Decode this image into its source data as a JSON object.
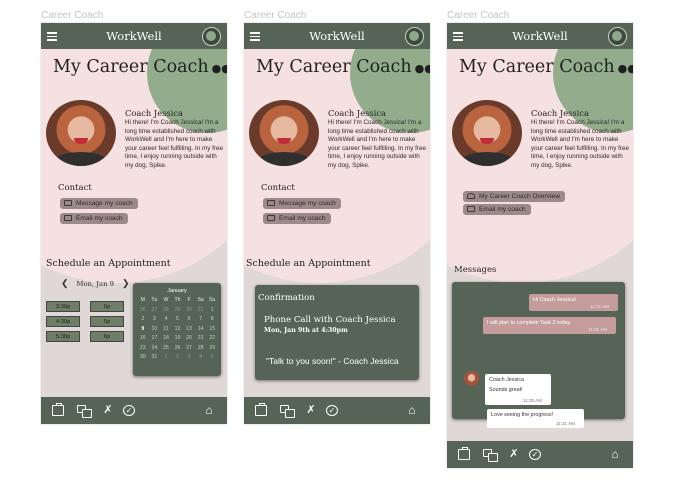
{
  "frames": [
    {
      "label": "Career Coach"
    },
    {
      "label": "Career Coach"
    },
    {
      "label": "Career Coach"
    }
  ],
  "app": {
    "title": "WorkWell"
  },
  "profile": {
    "heading": "My Career Coach",
    "owl_icon": "owl-icon",
    "coach_name": "Coach Jessica",
    "bio": "Hi there! I'm Coach Jessica! I'm a long time established coach with WorkWell and I'm here to make your career feel fulfilling. In my free time, I enjoy running outside with my dog, Spike."
  },
  "contact": {
    "title": "Contact",
    "message_label": "Message my coach",
    "email_label": "Email my coach"
  },
  "schedule": {
    "title": "Schedule an Appointment",
    "date": "Mon, Jan 9",
    "slots": [
      "3:30p",
      "6p",
      "4:30p",
      "5p",
      "5:30p",
      "6p"
    ]
  },
  "calendar": {
    "month": "January",
    "weekdays": [
      "M",
      "Tu",
      "W",
      "Th",
      "F",
      "Sa",
      "Su"
    ],
    "days": [
      "26",
      "27",
      "28",
      "29",
      "30",
      "31",
      "1",
      "2",
      "3",
      "4",
      "5",
      "6",
      "7",
      "8",
      "9",
      "10",
      "11",
      "12",
      "13",
      "14",
      "15",
      "16",
      "17",
      "18",
      "19",
      "20",
      "21",
      "22",
      "23",
      "24",
      "25",
      "26",
      "27",
      "28",
      "29",
      "30",
      "31",
      "1",
      "2",
      "3",
      "4",
      "5"
    ],
    "today": "9"
  },
  "confirmation": {
    "title": "Confirmation",
    "call": "Phone Call with Coach Jessica",
    "date": "Mon, Jan 9th at 4:30pm",
    "quote": "\"Talk to you soon!\" - Coach Jessica"
  },
  "frame3_links": {
    "overview_label": "My Career Coach Overview",
    "email_label": "Email my coach"
  },
  "messages": {
    "title": "Messages",
    "items": [
      {
        "text": "Hi Coach Jessica!",
        "time": "11:31 AM"
      },
      {
        "text": "I will plan to complete Task 2 today",
        "time": "11:31 AM"
      },
      {
        "author": "Coach Jessica",
        "text": "Sounds great!",
        "time": "11:35 AM"
      },
      {
        "text": "Love seeing the progress!",
        "time": "11:31 AM"
      }
    ]
  },
  "nav_icons": [
    "briefcase-icon",
    "chat-icon",
    "tools-icon",
    "check-circle-icon",
    "home-icon"
  ],
  "colors": {
    "primary": "#556456",
    "accent_green": "#93ad8c",
    "accent_pink": "#f6e1e2",
    "background": "#e0d8d7",
    "pill": "#9c8a8a",
    "bubble_out": "#c49c9b"
  }
}
